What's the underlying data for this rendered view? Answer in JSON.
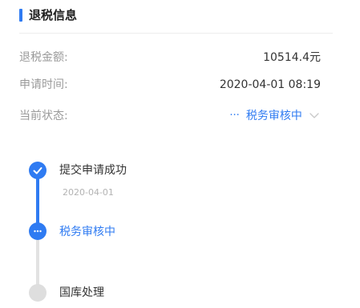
{
  "section": {
    "title": "退税信息"
  },
  "details": {
    "refund_amount_label": "退税金额:",
    "refund_amount_value": "10514.4元",
    "apply_time_label": "申请时间:",
    "apply_time_value": "2020-04-01 08:19",
    "status_label": "当前状态:",
    "status_dots": "···",
    "status_value": "税务审核中"
  },
  "timeline": {
    "steps": [
      {
        "label": "提交申请成功",
        "date": "2020-04-01",
        "state": "done"
      },
      {
        "label": "税务审核中",
        "state": "active"
      },
      {
        "label": "国库处理",
        "state": "pending"
      }
    ]
  },
  "colors": {
    "accent": "#2f7bf2",
    "pending": "#dedede",
    "label": "#9a9a9a"
  },
  "icons": {
    "done": "check-icon",
    "active": "ellipsis-icon",
    "status_toggle": "chevron-down-icon"
  }
}
